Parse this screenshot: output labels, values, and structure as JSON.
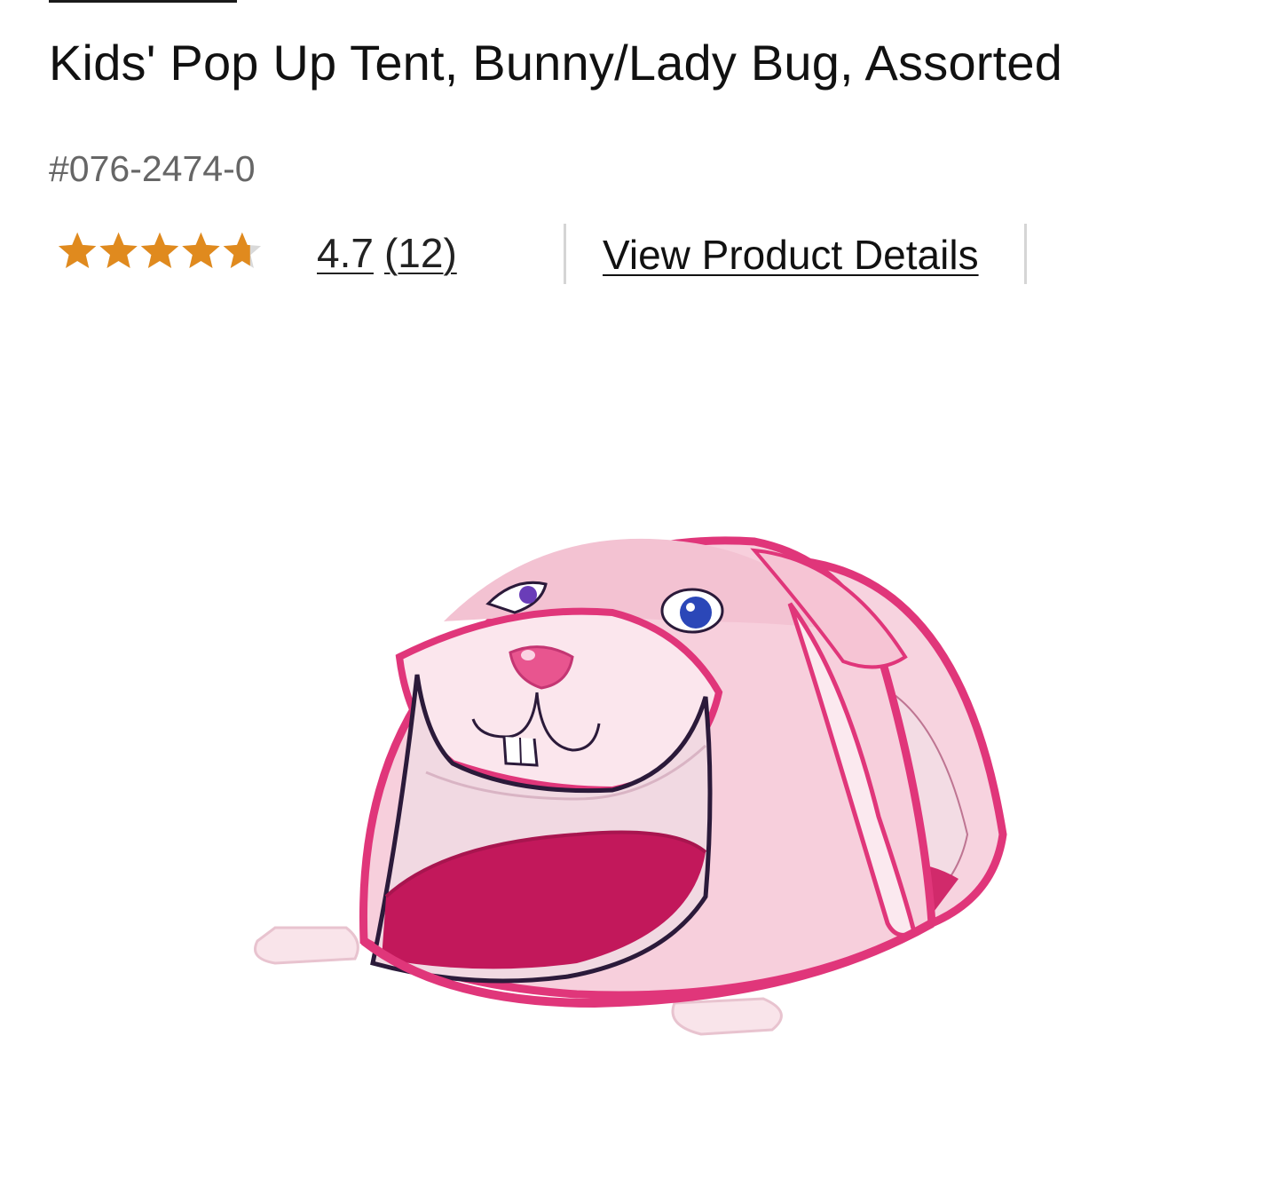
{
  "product": {
    "title": "Kids' Pop Up Tent, Bunny/Lady Bug, Assorted",
    "item_number": "#076-2474-0",
    "rating": {
      "value": "4.7",
      "count": "(12)",
      "stars_filled": 4.7,
      "stars_total": 5,
      "star_color": "#e08a1e",
      "star_empty_color": "#d9d9d9"
    },
    "details_link": "View Product Details",
    "image_icon": "bunny-pop-up-tent-photo"
  },
  "colors": {
    "tent_pink": "#f6c8d6",
    "tent_trim": "#e0367a",
    "tent_floor": "#c2185b",
    "text_primary": "#111111",
    "text_secondary": "#666666"
  }
}
